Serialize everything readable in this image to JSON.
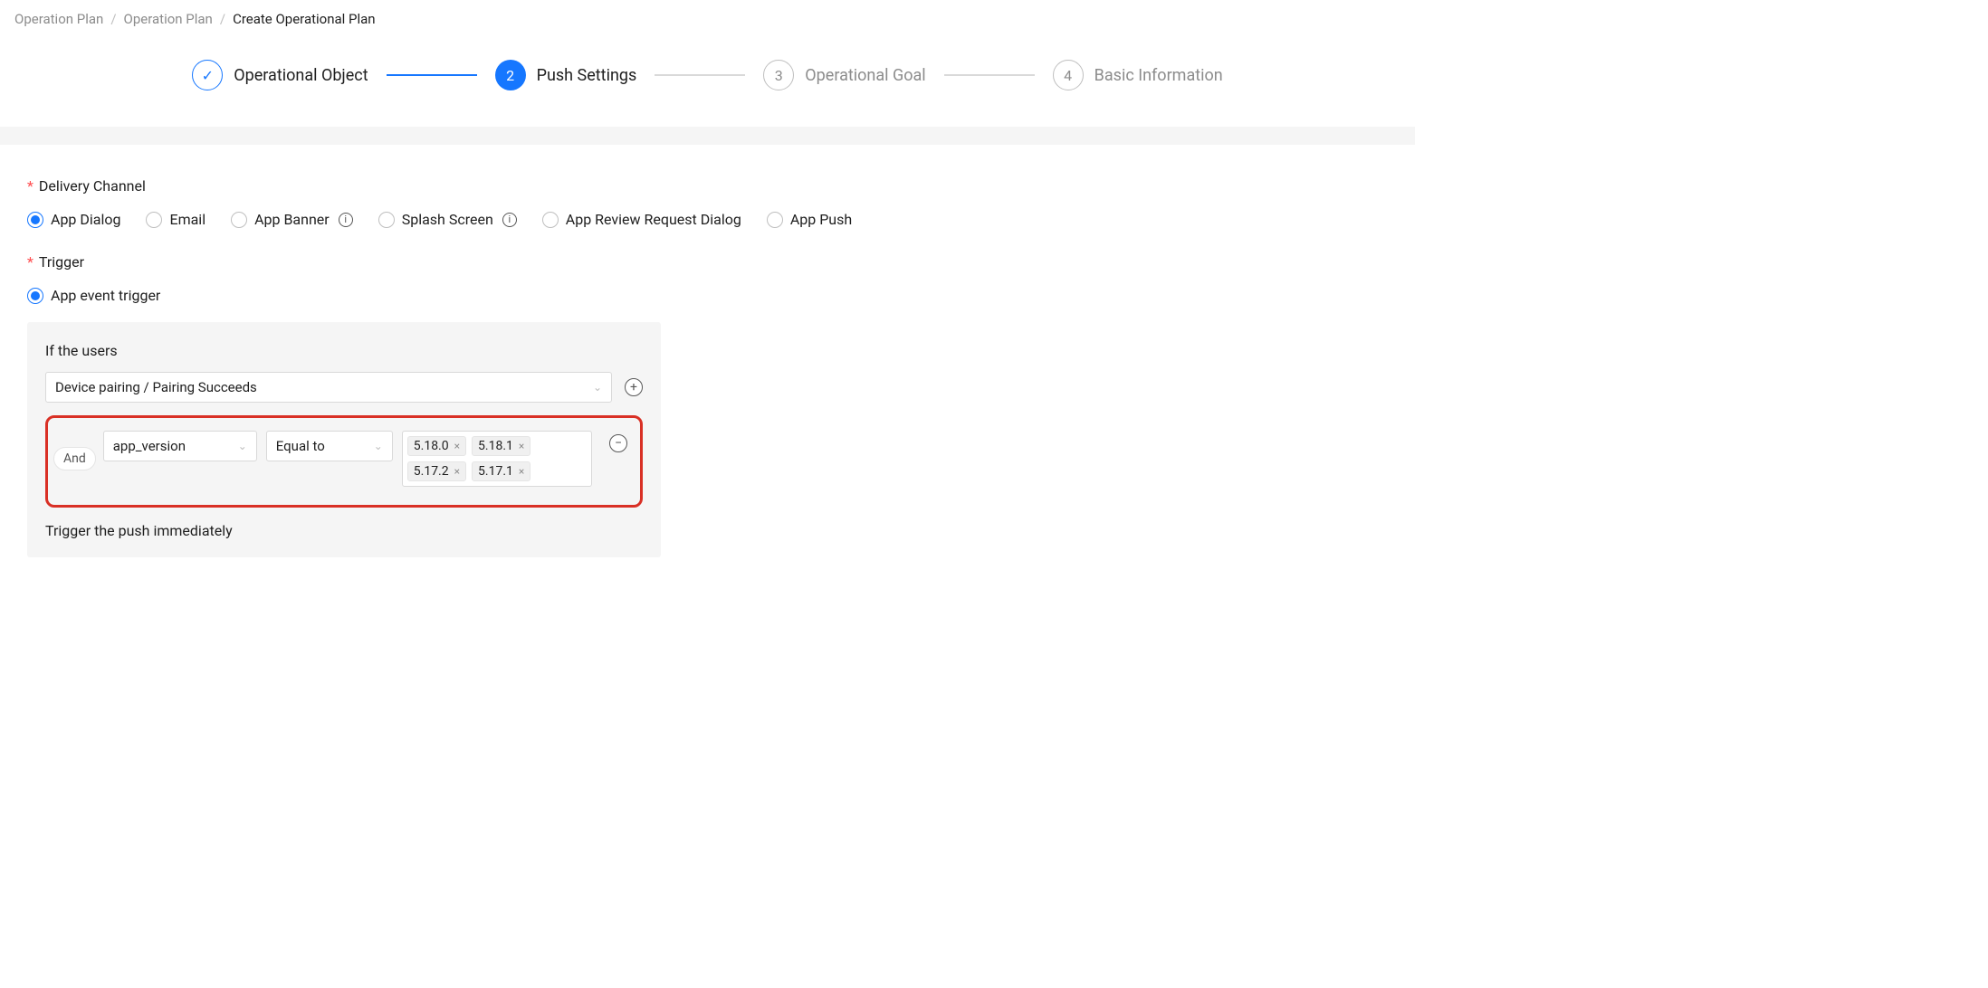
{
  "breadcrumb": {
    "items": [
      "Operation Plan",
      "Operation Plan",
      "Create Operational Plan"
    ],
    "active_index": 2
  },
  "steps": [
    {
      "label": "Operational Object",
      "status": "done"
    },
    {
      "label": "Push Settings",
      "status": "current",
      "num": "2"
    },
    {
      "label": "Operational Goal",
      "status": "pending",
      "num": "3"
    },
    {
      "label": "Basic Information",
      "status": "pending",
      "num": "4"
    }
  ],
  "form": {
    "delivery_channel": {
      "label": "Delivery Channel",
      "required": true,
      "options": [
        {
          "label": "App Dialog",
          "checked": true,
          "info": false
        },
        {
          "label": "Email",
          "checked": false,
          "info": false
        },
        {
          "label": "App Banner",
          "checked": false,
          "info": true
        },
        {
          "label": "Splash Screen",
          "checked": false,
          "info": true
        },
        {
          "label": "App Review Request Dialog",
          "checked": false,
          "info": false
        },
        {
          "label": "App Push",
          "checked": false,
          "info": false
        }
      ]
    },
    "trigger": {
      "label": "Trigger",
      "required": true,
      "options": [
        {
          "label": "App event trigger",
          "checked": true
        }
      ],
      "panel": {
        "heading": "If the users",
        "event_value": "Device pairing / Pairing Succeeds",
        "condition": {
          "joiner": "And",
          "field": "app_version",
          "operator": "Equal to",
          "values": [
            "5.18.0",
            "5.18.1",
            "5.17.2",
            "5.17.1"
          ]
        },
        "footer": "Trigger the push immediately"
      }
    }
  },
  "icons": {
    "check": "✓",
    "info": "i",
    "plus": "+",
    "minus": "−",
    "close": "×",
    "chevron_down": "⌄"
  }
}
